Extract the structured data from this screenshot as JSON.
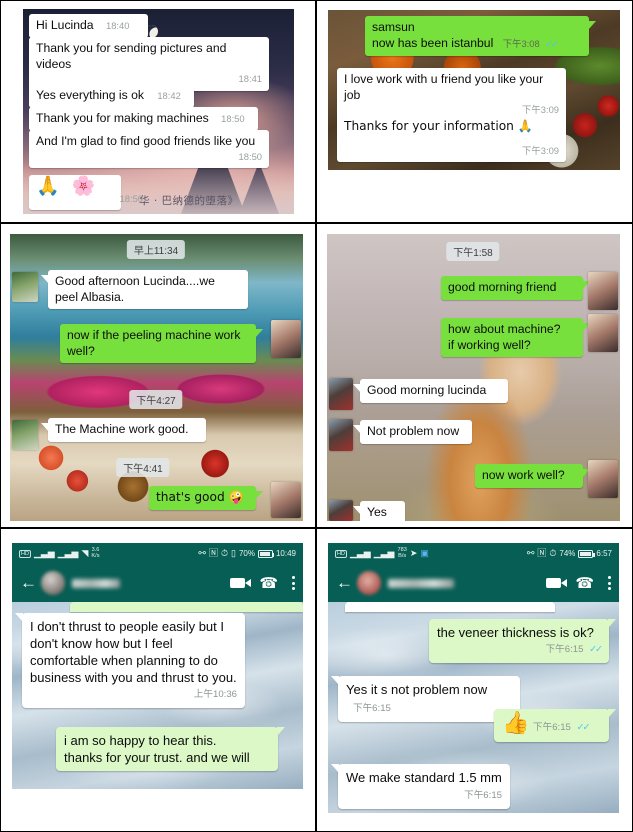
{
  "panels": [
    {
      "id": "panel-night-sky",
      "background": "night-sky-mountain-photo",
      "caption_cn": "华 · 巴纳德的堕落》",
      "messages": [
        {
          "side": "in",
          "text": "Hi Lucinda",
          "time": "18:40",
          "inline_time": true
        },
        {
          "side": "in",
          "text": "Thank you for sending pictures and videos",
          "time": "18:41",
          "inline_time": false
        },
        {
          "side": "in",
          "text": "Yes everything is ok",
          "time": "18:42",
          "inline_time": true
        },
        {
          "side": "in",
          "text": "Thank you for making machines",
          "time": "18:50",
          "inline_time": true
        },
        {
          "side": "in",
          "text": "And I'm glad to find good friends like you",
          "time": "18:50",
          "inline_time": false
        },
        {
          "side": "in",
          "text": "🙏 🌸",
          "time": "18:50",
          "inline_time": true,
          "emoji_only": true
        }
      ]
    },
    {
      "id": "panel-food-table",
      "background": "turkish-food-table-photo",
      "messages": [
        {
          "side": "out",
          "text": "samsun\nnow has been istanbul",
          "time": "下午3:08",
          "ticks": "✓✓"
        },
        {
          "side": "in",
          "text": "I love work with u friend you like your job",
          "time": "下午3:09"
        },
        {
          "side": "in",
          "text": "Thanks for your information 🙏",
          "time": "下午3:09"
        }
      ]
    },
    {
      "id": "panel-resort-breakfast",
      "background": "resort-pool-breakfast-photo",
      "daystamps": [
        "早上11:34",
        "下午4:27",
        "下午4:41"
      ],
      "messages": [
        {
          "side": "in",
          "text": "Good afternoon Lucinda....we peel Albasia."
        },
        {
          "side": "out",
          "text": "now if the peeling machine work well?"
        },
        {
          "side": "in",
          "text": "The Machine work good."
        },
        {
          "side": "out",
          "text": "that's good 🤪"
        }
      ]
    },
    {
      "id": "panel-corgi",
      "background": "corgi-blossom-photo",
      "daystamps": [
        "下午1:58"
      ],
      "messages": [
        {
          "side": "out",
          "text": "good morning friend"
        },
        {
          "side": "out",
          "text": "how about machine?\nif working well?"
        },
        {
          "side": "in",
          "text": "Good morning lucinda"
        },
        {
          "side": "in",
          "text": "Not problem now"
        },
        {
          "side": "out",
          "text": "now work well?"
        },
        {
          "side": "in",
          "text": "Yes"
        }
      ]
    },
    {
      "id": "panel-phone-trust",
      "statusbar": {
        "left_icons": [
          "hd-icon",
          "signal-icon-1",
          "signal-icon-2",
          "wifi-icon"
        ],
        "net_rate_value": "3.6",
        "net_rate_unit": "K/s",
        "right_icons": [
          "key-icon",
          "nfc-icon",
          "alarm-icon",
          "vibrate-icon"
        ],
        "battery_percent": "70%",
        "clock": "10:49"
      },
      "appbar": {
        "back": "back-arrow-icon",
        "contact_name": "",
        "icons": [
          "video-call-icon",
          "voice-call-icon",
          "overflow-menu-icon"
        ]
      },
      "messages": [
        {
          "side": "in",
          "text": "I don't thrust to people easily but I  don't know how but I feel comfortable when planning to do business with you and thrust to you.",
          "time": "上午10:36"
        },
        {
          "side": "out",
          "text": "i am so happy to hear this.\nthanks for your trust. and we will"
        }
      ]
    },
    {
      "id": "panel-phone-veneer",
      "statusbar": {
        "left_icons": [
          "hd-icon",
          "signal-icon-1",
          "signal-icon-2",
          "cursor-icon",
          "photos-icon"
        ],
        "net_rate_value": "783",
        "net_rate_unit": "B/s",
        "right_icons": [
          "key-icon",
          "nfc-icon",
          "alarm-icon"
        ],
        "battery_percent": "74%",
        "clock": "6:57"
      },
      "appbar": {
        "back": "back-arrow-icon",
        "contact_name": "",
        "icons": [
          "video-call-icon",
          "voice-call-icon",
          "overflow-menu-icon"
        ]
      },
      "messages": [
        {
          "side": "out",
          "text": "the veneer thickness is ok?",
          "time": "下午6:15",
          "ticks": "✓✓"
        },
        {
          "side": "in",
          "text": "Yes it s not problem now",
          "time": "下午6:15",
          "inline_time": true
        },
        {
          "side": "out",
          "text": "👍",
          "time": "下午6:15",
          "ticks": "✓✓",
          "emoji_only": true
        },
        {
          "side": "in",
          "text": "We make standard 1.5 mm",
          "time": "下午6:15"
        }
      ]
    }
  ],
  "colors": {
    "whatsapp_green": "#075e54",
    "out_bubble": "#dcf8c6",
    "out_bubble_bright": "#78e03c",
    "in_bubble": "#ffffff",
    "tick_blue": "#4fc3f7",
    "timestamp_grey": "#9aa0a0"
  }
}
